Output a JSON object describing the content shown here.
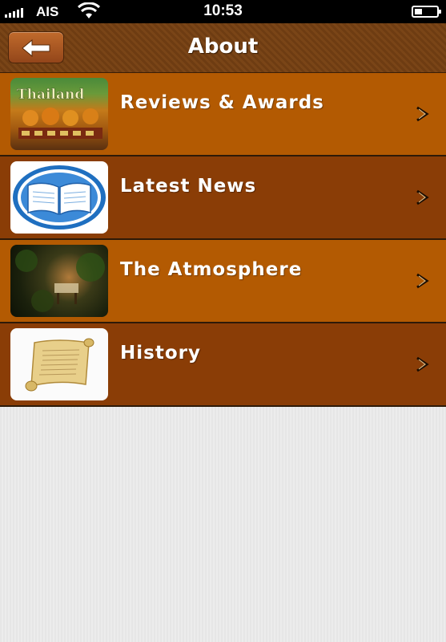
{
  "status_bar": {
    "carrier": "AIS",
    "time": "10:53"
  },
  "nav": {
    "title": "About",
    "back_icon": "back-arrow-icon"
  },
  "thumbnail_texts": {
    "reviews": "Thailand"
  },
  "menu_items": [
    {
      "label": "Reviews & Awards",
      "icon": "thailand-book-thumbnail",
      "style": "light"
    },
    {
      "label": "Latest News",
      "icon": "open-book-icon",
      "style": "dark"
    },
    {
      "label": "The Atmosphere",
      "icon": "atmosphere-photo-thumbnail",
      "style": "light"
    },
    {
      "label": "History",
      "icon": "scroll-icon",
      "style": "dark"
    }
  ],
  "colors": {
    "row_light": "#b35a02",
    "row_dark": "#8a3d06",
    "nav_bg": "#7a4517"
  }
}
